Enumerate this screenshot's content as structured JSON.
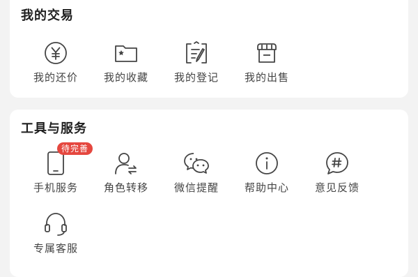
{
  "trade": {
    "title": "我的交易",
    "items": [
      {
        "label": "我的还价",
        "icon": "yuan-circle-icon"
      },
      {
        "label": "我的收藏",
        "icon": "folder-star-icon"
      },
      {
        "label": "我的登记",
        "icon": "register-edit-icon"
      },
      {
        "label": "我的出售",
        "icon": "shop-icon"
      }
    ]
  },
  "tools": {
    "title": "工具与服务",
    "items": [
      {
        "label": "手机服务",
        "icon": "phone-icon",
        "badge": "待完善"
      },
      {
        "label": "角色转移",
        "icon": "role-transfer-icon"
      },
      {
        "label": "微信提醒",
        "icon": "wechat-icon"
      },
      {
        "label": "帮助中心",
        "icon": "info-icon"
      },
      {
        "label": "意见反馈",
        "icon": "feedback-icon"
      },
      {
        "label": "专属客服",
        "icon": "headset-icon"
      }
    ]
  },
  "colors": {
    "badge": "#e5473f",
    "icon_stroke": "#444444",
    "background": "#f3f3f3",
    "card": "#ffffff"
  }
}
